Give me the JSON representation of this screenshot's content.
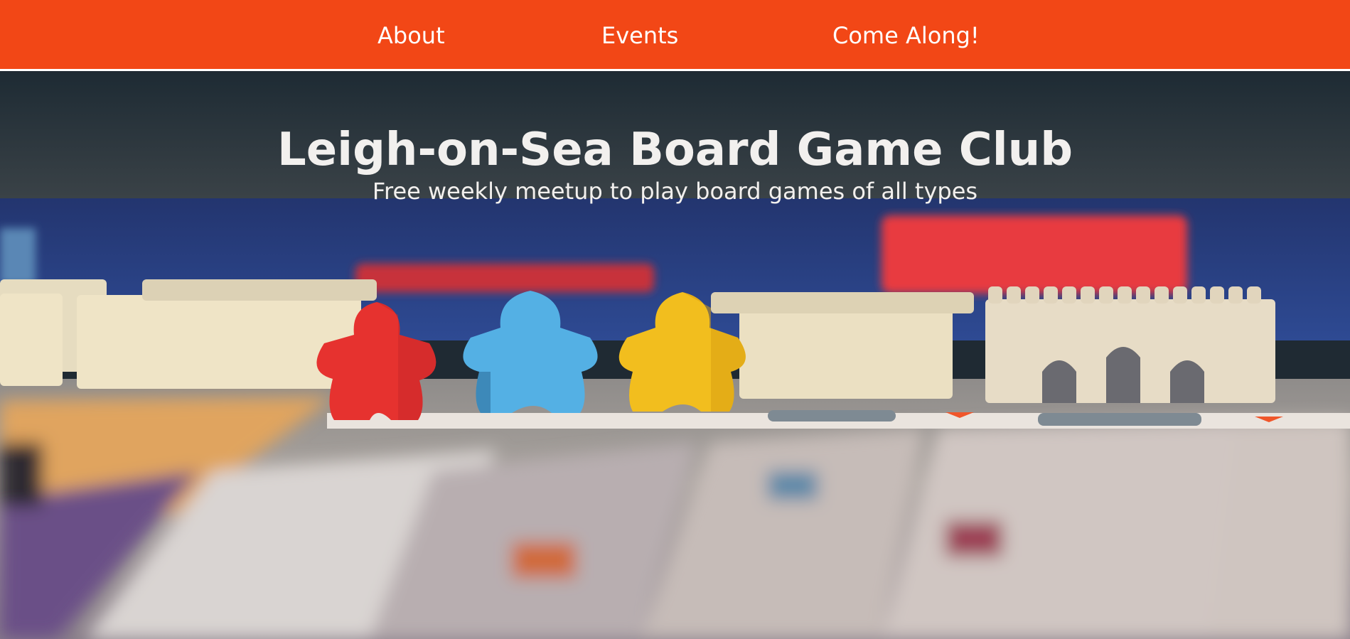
{
  "nav": {
    "items": [
      {
        "label": "About"
      },
      {
        "label": "Events"
      },
      {
        "label": "Come Along!"
      }
    ],
    "background": "#f24716"
  },
  "hero": {
    "title": "Leigh-on-Sea Board Game Club",
    "subtitle": "Free weekly meetup to play board games of all types",
    "image_subject": "red, blue and yellow meeples standing on a game board beside wall pieces"
  }
}
